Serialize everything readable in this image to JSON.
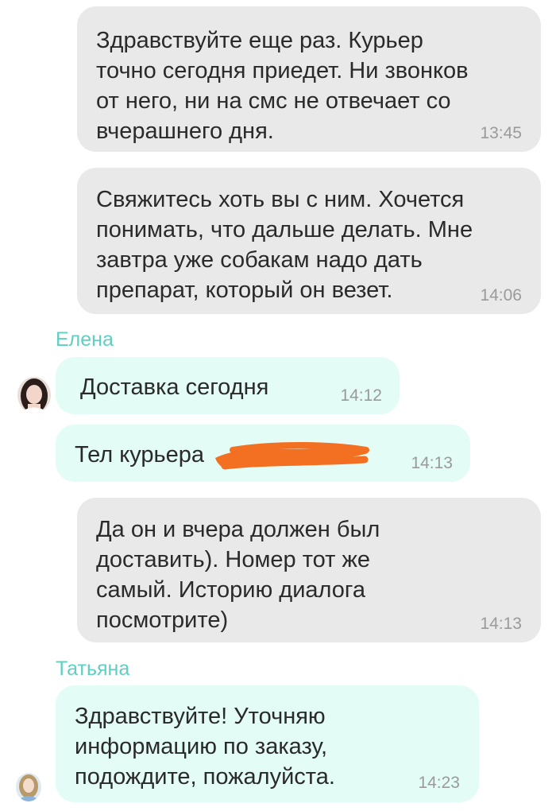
{
  "messages": [
    {
      "direction": "out",
      "text": "Здравствуйте еще раз. Курьер\nточно сегодня приедет. Ни звонков\nот него, ни на смс не отвечает со\nвчерашнего дня.",
      "time": "13:45"
    },
    {
      "direction": "out",
      "text": "Свяжитесь хоть вы с ним. Хочется\nпонимать, что дальше делать. Мне\nзавтра уже собакам надо дать\nпрепарат, который он везет.",
      "time": "14:06"
    },
    {
      "direction": "in",
      "sender": "Елена",
      "text": "Доставка сегодня",
      "time": "14:12"
    },
    {
      "direction": "in",
      "text": "Тел курьера",
      "time": "14:13",
      "redacted": true
    },
    {
      "direction": "out",
      "text": "Да он и вчера должен был\nдоставить). Номер тот же\nсамый. Историю диалога\nпосмотрите)",
      "time": "14:13"
    },
    {
      "direction": "in",
      "sender": "Татьяна",
      "text": "Здравствуйте! Уточняю\nинформацию по заказу,\nподождите, пожалуйста.",
      "time": "14:23"
    }
  ],
  "colors": {
    "outgoing_bubble": "#e9e9e9",
    "incoming_bubble": "#e3fcf5",
    "sender_name": "#5ecfc0",
    "timestamp": "#9a9a9a",
    "redaction": "#f36f21"
  }
}
